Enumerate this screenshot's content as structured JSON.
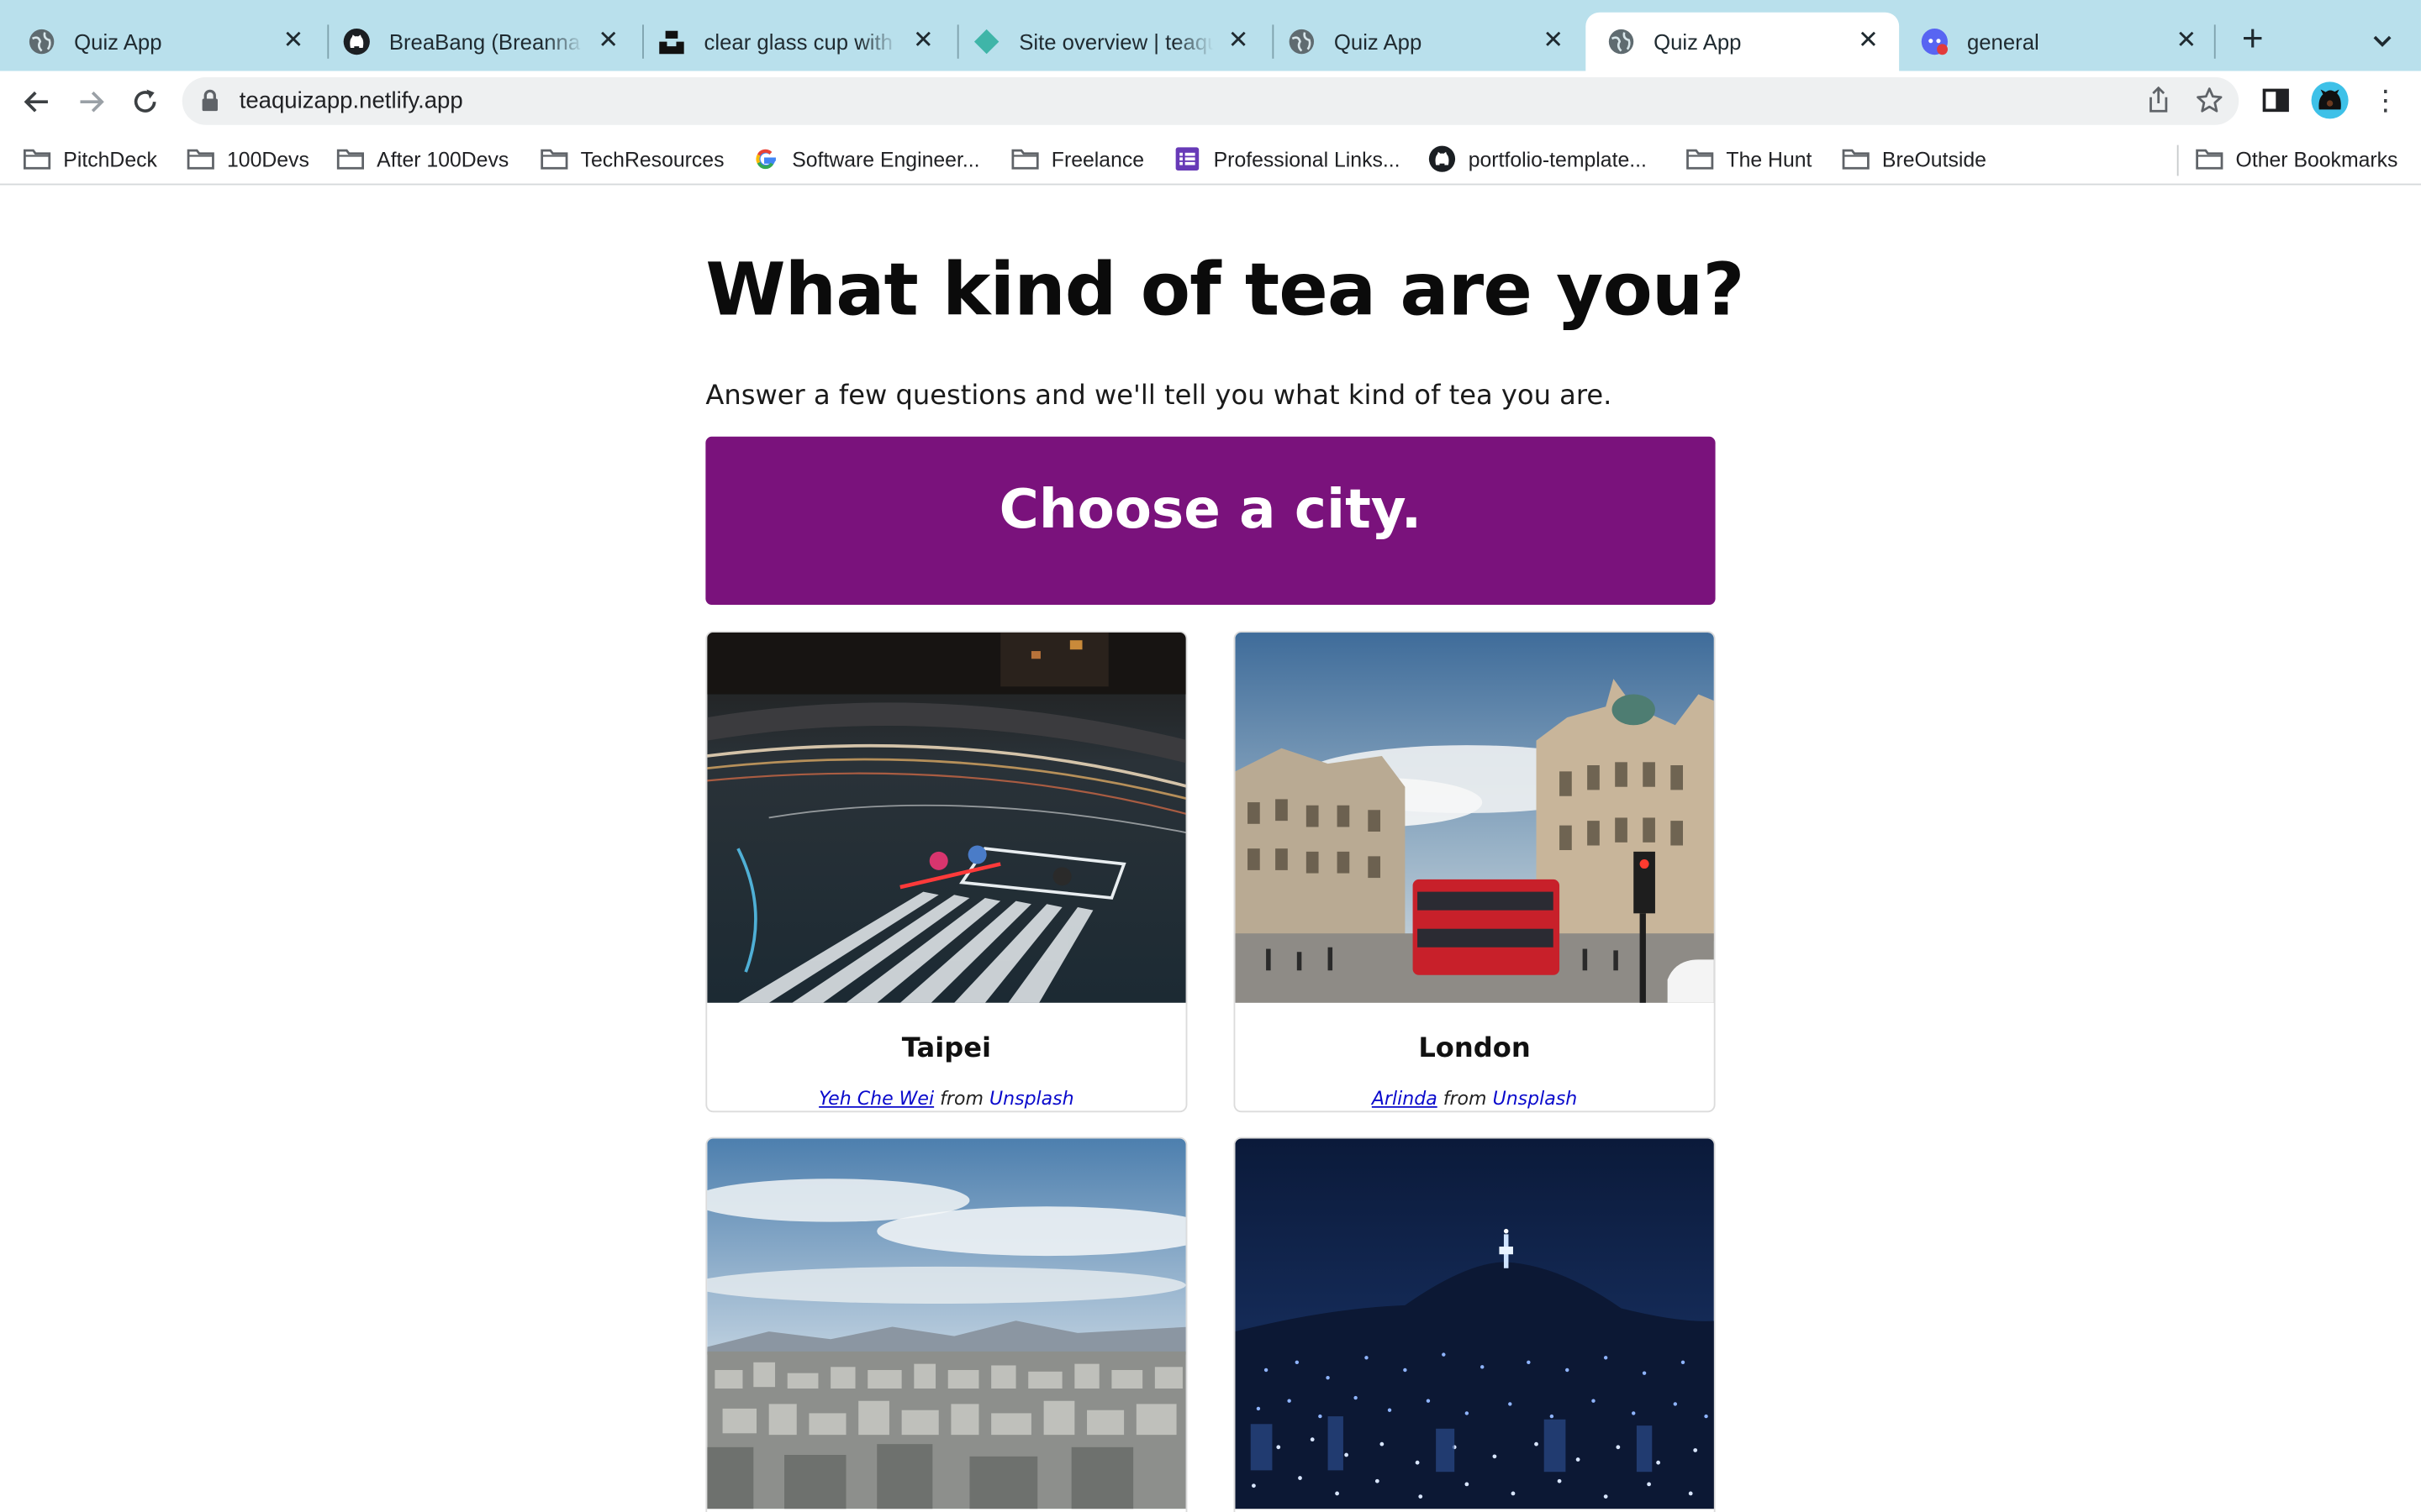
{
  "browser": {
    "tabs": [
      {
        "title": "Quiz App",
        "icon": "globe-icon",
        "active": false
      },
      {
        "title": "BreaBang (Breanna Bang)",
        "icon": "github-icon",
        "active": false
      },
      {
        "title": "clear glass cup with black tea",
        "icon": "unsplash-icon",
        "active": false
      },
      {
        "title": "Site overview | teaquizapp",
        "icon": "netlify-icon",
        "active": false
      },
      {
        "title": "Quiz App",
        "icon": "globe-icon",
        "active": false
      },
      {
        "title": "Quiz App",
        "icon": "globe-icon",
        "active": true
      },
      {
        "title": "general",
        "icon": "discord-icon",
        "active": false
      }
    ],
    "url": "teaquizapp.netlify.app",
    "bookmarks": [
      {
        "label": "PitchDeck",
        "icon": "folder-icon"
      },
      {
        "label": "100Devs",
        "icon": "folder-icon"
      },
      {
        "label": "After 100Devs",
        "icon": "folder-icon"
      },
      {
        "label": "TechResources",
        "icon": "folder-icon"
      },
      {
        "label": "Software Engineer...",
        "icon": "google-icon"
      },
      {
        "label": "Freelance",
        "icon": "folder-icon"
      },
      {
        "label": "Professional Links...",
        "icon": "forms-icon"
      },
      {
        "label": "portfolio-template...",
        "icon": "github-icon"
      },
      {
        "label": "The Hunt",
        "icon": "folder-icon"
      },
      {
        "label": "BreOutside",
        "icon": "folder-icon"
      }
    ],
    "other_bookmarks": "Other Bookmarks"
  },
  "quiz": {
    "title": "What kind of tea are you?",
    "subtitle": "Answer a few questions and we'll tell you what kind of tea you are.",
    "question": "Choose a city.",
    "accent_color": "#7a127c",
    "answers": [
      {
        "city": "Taipei",
        "photographer": "Yeh Che Wei",
        "from": "from",
        "source": "Unsplash"
      },
      {
        "city": "London",
        "photographer": "Arlinda",
        "from": "from",
        "source": "Unsplash"
      },
      {
        "city": "",
        "photographer": "",
        "from": "",
        "source": ""
      },
      {
        "city": "",
        "photographer": "",
        "from": "",
        "source": ""
      }
    ]
  }
}
